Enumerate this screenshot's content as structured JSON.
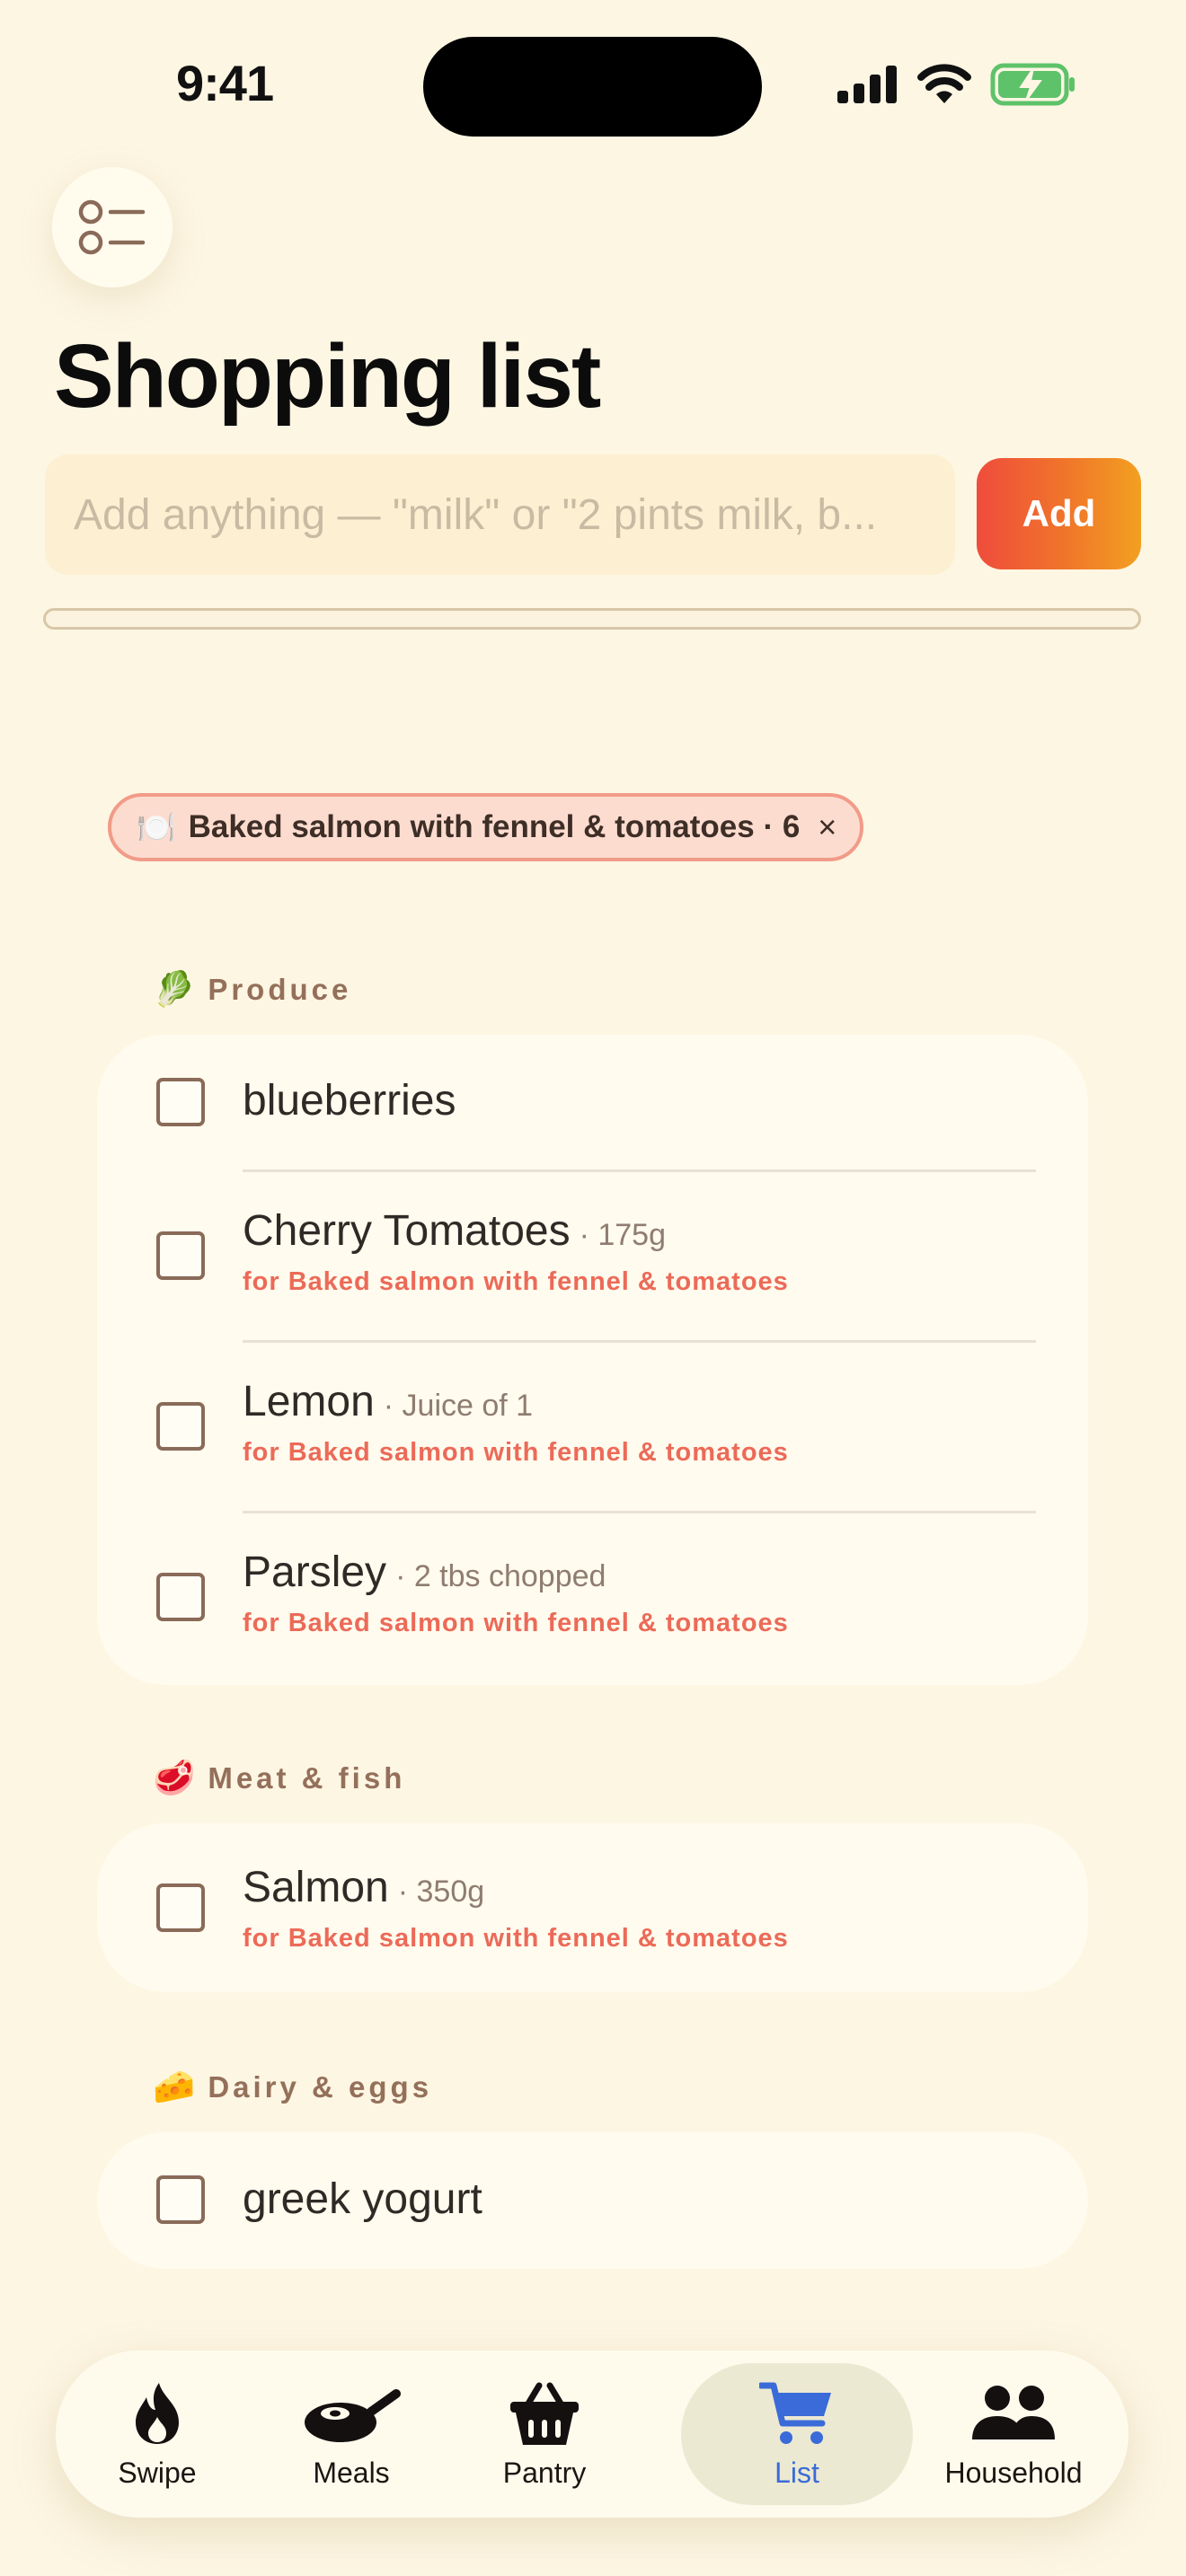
{
  "status": {
    "time": "9:41"
  },
  "header": {
    "title": "Shopping list",
    "menu_icon": "list-icon"
  },
  "add": {
    "placeholder": "Add anything — \"milk\" or \"2 pints milk, b...",
    "button_label": "Add"
  },
  "progress": {
    "fraction": 0
  },
  "meal_filter": {
    "emoji": "🍽️",
    "label": "Baked salmon with fennel & tomatoes · 6",
    "remove": "×"
  },
  "categories": [
    {
      "emoji": "🥬",
      "name": "Produce",
      "items": [
        {
          "name": "blueberries",
          "qty": "",
          "for": ""
        },
        {
          "name": "Cherry Tomatoes",
          "qty": "· 175g",
          "for": "for Baked salmon with fennel & tomatoes"
        },
        {
          "name": "Lemon",
          "qty": "· Juice of 1",
          "for": "for Baked salmon with fennel & tomatoes"
        },
        {
          "name": "Parsley",
          "qty": "· 2 tbs chopped",
          "for": "for Baked salmon with fennel & tomatoes"
        }
      ]
    },
    {
      "emoji": "🥩",
      "name": "Meat & fish",
      "items": [
        {
          "name": "Salmon",
          "qty": "· 350g",
          "for": "for Baked salmon with fennel & tomatoes"
        }
      ]
    },
    {
      "emoji": "🧀",
      "name": "Dairy & eggs",
      "items": [
        {
          "name": "greek yogurt",
          "qty": "",
          "for": ""
        }
      ]
    }
  ],
  "tabs": [
    {
      "label": "Swipe",
      "icon": "flame-icon",
      "active": false
    },
    {
      "label": "Meals",
      "icon": "pan-icon",
      "active": false
    },
    {
      "label": "Pantry",
      "icon": "basket-icon",
      "active": false
    },
    {
      "label": "List",
      "icon": "cart-icon",
      "active": true
    },
    {
      "label": "Household",
      "icon": "people-icon",
      "active": false
    }
  ],
  "colors": {
    "background": "#fdf6e3",
    "accent": "#ec6a58",
    "active_tab": "#3a6bd8"
  }
}
